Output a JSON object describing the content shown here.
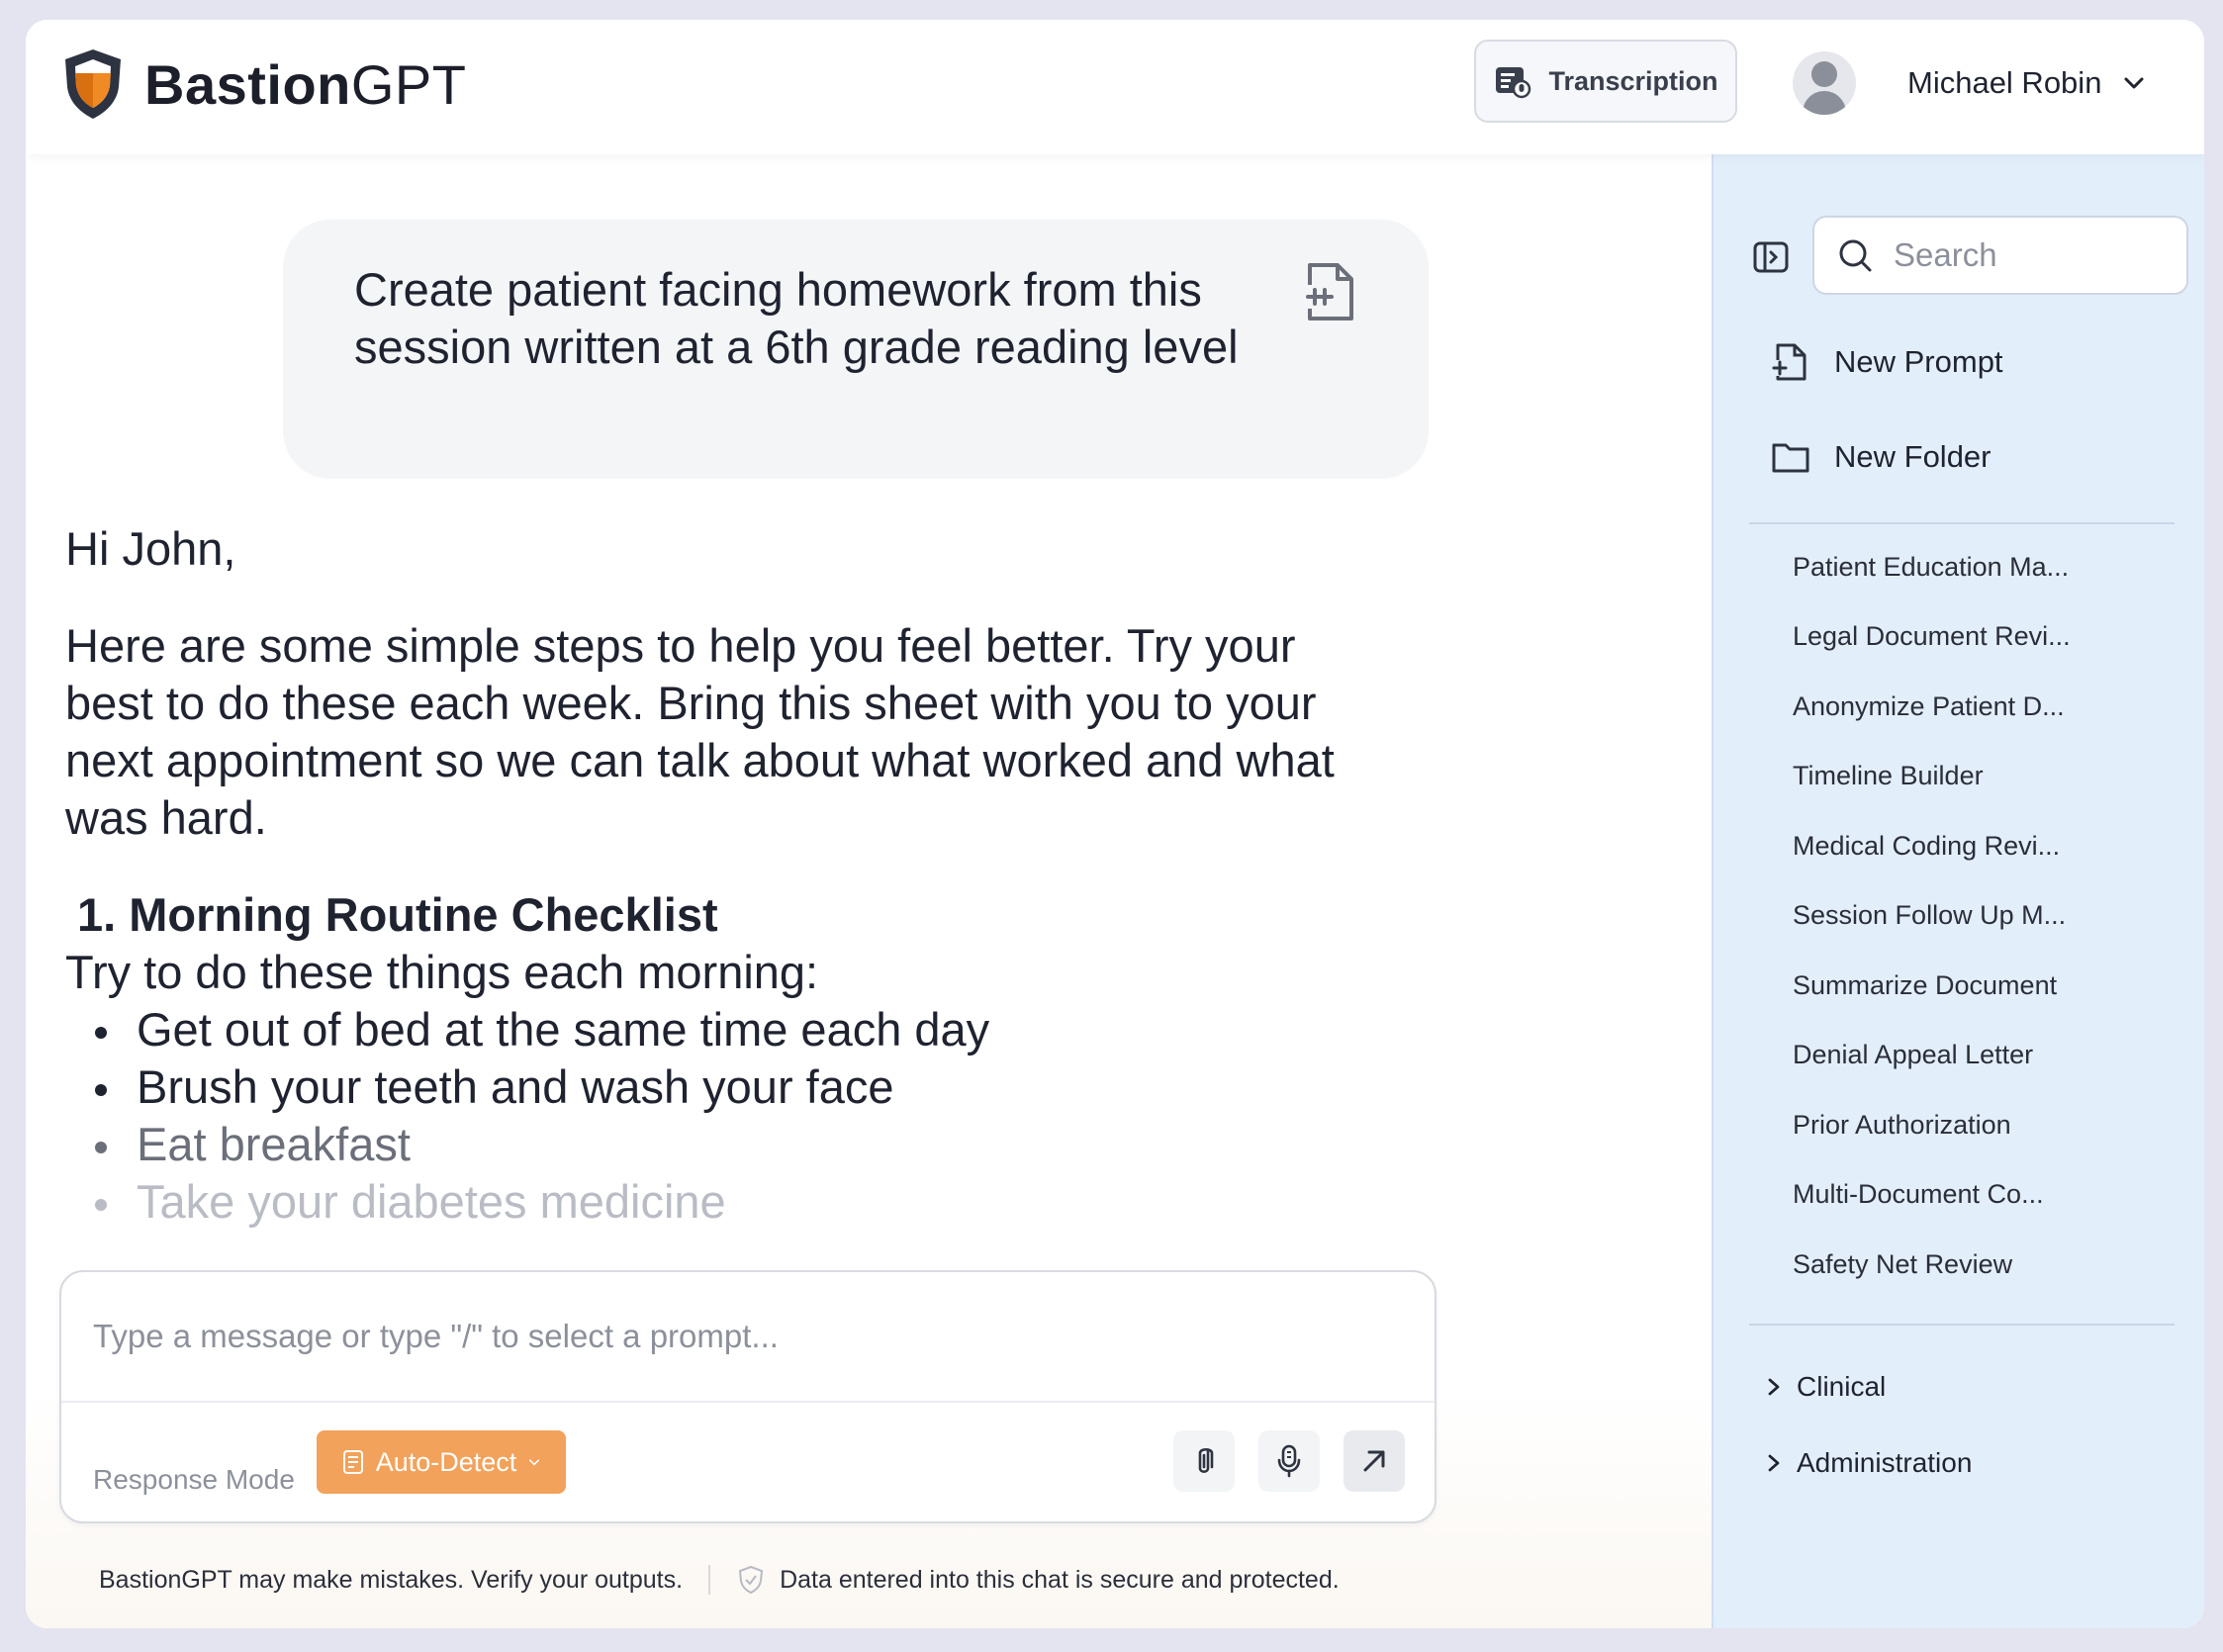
{
  "header": {
    "logo_bold": "Bastion",
    "logo_light": "GPT",
    "transcription_label": "Transcription",
    "user_name": "Michael Robin"
  },
  "chat": {
    "user_prompt": "Create patient facing homework from this session written at a 6th grade reading level",
    "reply": {
      "greeting": "Hi John,",
      "intro": "Here are some simple steps to help you feel better. Try your best to do these each week. Bring this sheet with you to your next appointment so we can talk about what worked and what was hard.",
      "section_title": "1. Morning Routine Checklist",
      "section_intro": "Try to do these things each morning:",
      "items": [
        "Get out of bed at the same time each day",
        "Brush your teeth and wash your face",
        "Eat breakfast",
        "Take your diabetes medicine"
      ]
    },
    "input_placeholder": "Type a message or type \"/\" to select a prompt...",
    "response_mode_label": "Response Mode",
    "auto_detect_label": "Auto-Detect",
    "disclaimer_left": "BastionGPT may make mistakes. Verify your outputs.",
    "disclaimer_right": "Data entered into this chat is secure and protected."
  },
  "sidebar": {
    "search_placeholder": "Search",
    "new_prompt_label": "New Prompt",
    "new_folder_label": "New Folder",
    "prompts": [
      "Patient Education Ma...",
      "Legal Document Revi...",
      "Anonymize Patient D...",
      "Timeline Builder",
      "Medical Coding Revi...",
      "Session Follow Up M...",
      "Summarize Document",
      "Denial Appeal Letter",
      "Prior Authorization",
      "Multi-Document Co...",
      "Safety Net Review"
    ],
    "folders": [
      "Clinical",
      "Administration"
    ]
  },
  "colors": {
    "accent_orange": "#f2a25b",
    "sidebar_bg": "#e3eefb",
    "shield_dark": "#2d3340",
    "shield_orange": "#f08a24"
  },
  "icons": {
    "logo": "shield-logo-icon",
    "transcription": "transcription-icon",
    "prompt_attach": "file-plus-icon",
    "attach": "paperclip-icon",
    "mic": "microphone-icon",
    "send": "arrow-up-right-icon",
    "secure": "shield-check-icon",
    "sidebar_toggle": "sidebar-toggle-icon",
    "search": "search-icon",
    "new_prompt": "file-plus-icon",
    "new_folder": "folder-icon",
    "folder_chevron": "chevron-right-icon"
  }
}
